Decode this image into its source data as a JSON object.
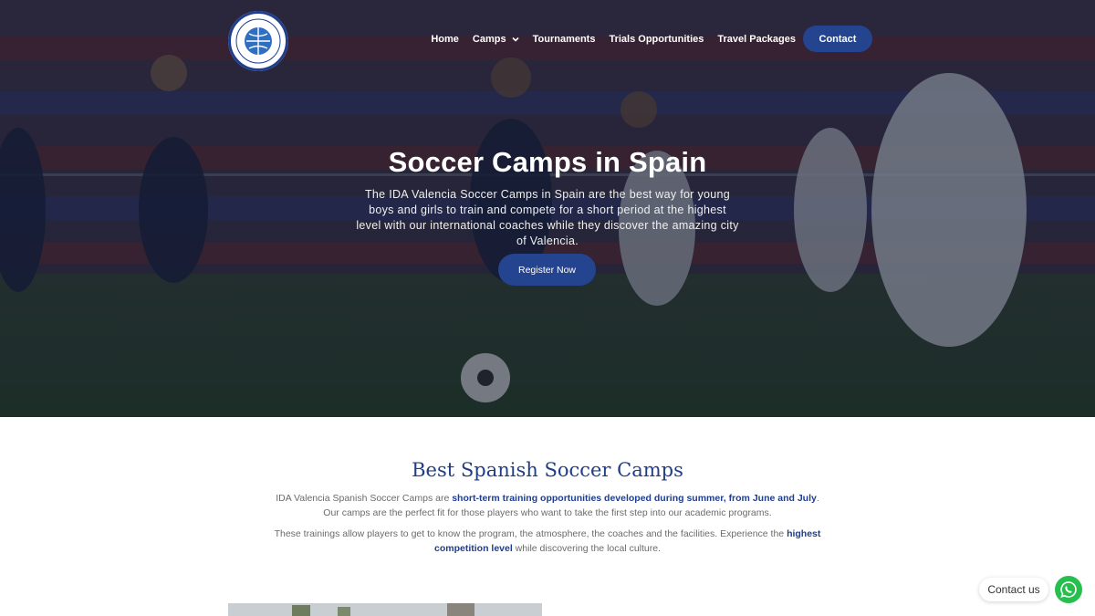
{
  "nav": {
    "logo_alt": "International Development Academy",
    "items": [
      {
        "label": "Home"
      },
      {
        "label": "Camps",
        "has_dropdown": true
      },
      {
        "label": "Tournaments"
      },
      {
        "label": "Trials Opportunities"
      },
      {
        "label": "Travel Packages"
      }
    ],
    "contact_label": "Contact"
  },
  "hero": {
    "title": "Soccer Camps in Spain",
    "description": "The IDA Valencia Soccer Camps in Spain are the best way for young boys and girls to train and compete for a short period at the highest level with our international coaches while they discover the amazing city of Valencia.",
    "cta_label": "Register Now"
  },
  "section": {
    "title": "Best Spanish Soccer Camps",
    "p1_start": "IDA Valencia Spanish Soccer Camps are ",
    "p1_bold": "short-term training opportunities developed during summer, from June and July",
    "p1_end": ". Our camps are the perfect fit for those players who want to take the first step into our academic programs.",
    "p2_start": "These trainings allow players to get to know the program, the atmosphere, the coaches and the facilities. Experience the ",
    "p2_bold": "highest competition level",
    "p2_end": " while discovering the local culture."
  },
  "chat": {
    "label": "Contact us",
    "icon": "whatsapp-icon"
  },
  "colors": {
    "brand_blue": "#25448f",
    "heading_blue": "#203d86",
    "whatsapp_green": "#26bf4e"
  }
}
